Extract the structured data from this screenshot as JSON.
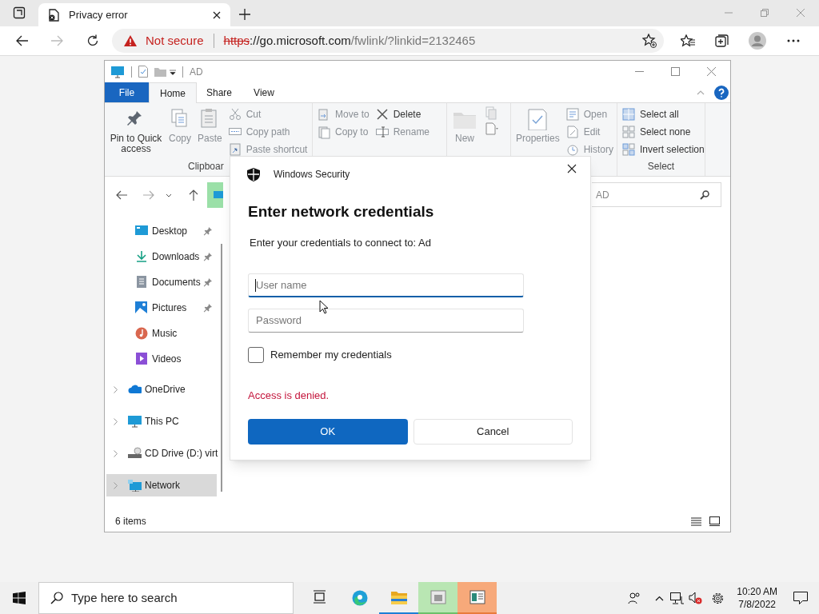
{
  "browser": {
    "tabs": [
      {
        "title": "Privacy error",
        "selected": true
      }
    ],
    "address": {
      "security": "Not secure",
      "scheme": "https",
      "host": "://go.microsoft.com",
      "path": "/fwlink/?linkid=2132465"
    }
  },
  "explorer": {
    "title": "AD",
    "ribbon_tabs": [
      {
        "label": "File",
        "kind": "file",
        "selected": false
      },
      {
        "label": "Home",
        "kind": "tab",
        "selected": true
      },
      {
        "label": "Share",
        "kind": "tab",
        "selected": false
      },
      {
        "label": "View",
        "kind": "tab",
        "selected": false
      }
    ],
    "ribbon": {
      "groups": [
        {
          "label": "Clipboar",
          "columns": [
            [
              {
                "label": "Pin to Quick access",
                "kind": "pin",
                "disabled": false
              }
            ],
            [
              {
                "label": "Copy",
                "kind": "copy",
                "disabled": true
              }
            ],
            [
              {
                "label": "Paste",
                "kind": "paste",
                "disabled": true
              }
            ],
            [
              {
                "label": "Cut",
                "kind": "cut",
                "disabled": true
              },
              {
                "label": "Copy path",
                "kind": "copypath",
                "disabled": true
              },
              {
                "label": "Paste shortcut",
                "kind": "pasteshortcut",
                "disabled": true
              }
            ]
          ]
        },
        {
          "columns": [
            [
              {
                "label": "Move to",
                "kind": "moveto",
                "disabled": true
              },
              {
                "label": "Copy to",
                "kind": "copyto",
                "disabled": true
              }
            ],
            [
              {
                "label": "Delete",
                "kind": "delete",
                "disabled": false
              },
              {
                "label": "Rename",
                "kind": "rename",
                "disabled": true
              }
            ]
          ]
        },
        {
          "columns": [
            [
              {
                "label": "New",
                "kind": "newfolder",
                "disabled": true
              }
            ],
            [
              {
                "kind": "newitem",
                "disabled": true
              },
              {
                "kind": "easyaccess",
                "disabled": true
              }
            ]
          ]
        },
        {
          "columns": [
            [
              {
                "label": "Properties",
                "kind": "properties",
                "disabled": true
              }
            ],
            [
              {
                "label": "Open",
                "kind": "open",
                "disabled": true
              },
              {
                "label": "Edit",
                "kind": "edit",
                "disabled": true
              },
              {
                "label": "History",
                "kind": "history",
                "disabled": true
              }
            ]
          ]
        },
        {
          "label": "Select",
          "columns": [
            [
              {
                "label": "Select all",
                "kind": "selectall",
                "disabled": false
              },
              {
                "label": "Select none",
                "kind": "selectnone",
                "disabled": false
              },
              {
                "label": "Invert selection",
                "kind": "invert",
                "disabled": false
              }
            ]
          ]
        }
      ]
    },
    "search": {
      "placeholder": "AD"
    },
    "quick_access": [
      {
        "label": "Desktop",
        "kind": "desktop",
        "pinned": true
      },
      {
        "label": "Downloads",
        "kind": "downloads",
        "pinned": true
      },
      {
        "label": "Documents",
        "kind": "documents",
        "pinned": true
      },
      {
        "label": "Pictures",
        "kind": "pictures",
        "pinned": true
      },
      {
        "label": "Music",
        "kind": "music",
        "pinned": false
      },
      {
        "label": "Videos",
        "kind": "videos",
        "pinned": false
      }
    ],
    "locations": [
      {
        "label": "OneDrive",
        "kind": "onedrive",
        "selected": false
      },
      {
        "label": "This PC",
        "kind": "pc",
        "selected": false
      },
      {
        "label": "CD Drive (D:) virt",
        "kind": "cd",
        "selected": false
      },
      {
        "label": "Network",
        "kind": "network",
        "selected": true
      }
    ],
    "status": "6 items"
  },
  "dialog": {
    "title": "Windows Security",
    "heading": "Enter network credentials",
    "message": "Enter your credentials to connect to: Ad",
    "fields": [
      {
        "placeholder": "User name",
        "focused": true
      },
      {
        "placeholder": "Password",
        "focused": false
      }
    ],
    "remember": {
      "label": "Remember my credentials",
      "checked": false
    },
    "error": "Access is denied.",
    "buttons": [
      {
        "label": "OK",
        "primary": true
      },
      {
        "label": "Cancel",
        "primary": false
      }
    ]
  },
  "taskbar": {
    "search_placeholder": "Type here to search",
    "apps": [
      {
        "kind": "taskview",
        "active": false
      },
      {
        "kind": "edge",
        "active": false
      },
      {
        "kind": "explorer",
        "active": true
      },
      {
        "kind": "green",
        "active": false
      },
      {
        "kind": "orange",
        "active": false
      }
    ],
    "time": "10:20 AM",
    "date": "7/8/2022"
  }
}
